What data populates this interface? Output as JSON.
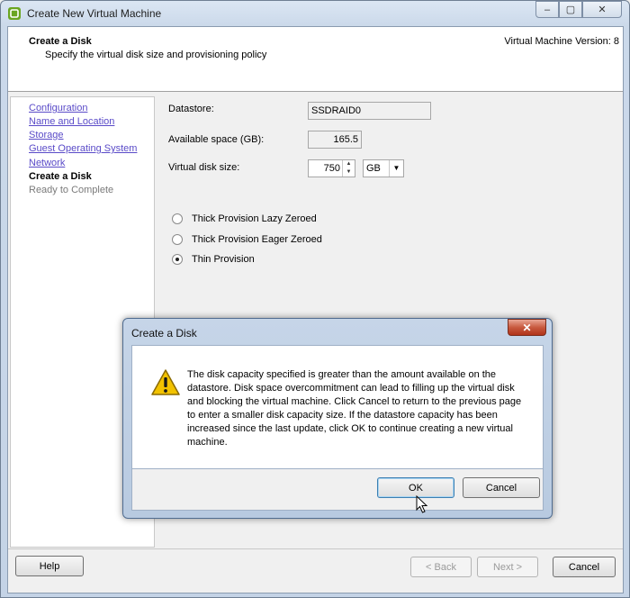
{
  "window": {
    "title": "Create New Virtual Machine",
    "controls": {
      "minimize": "–",
      "maximize": "▢",
      "close": "✕"
    }
  },
  "header": {
    "title": "Create a Disk",
    "subtitle": "Specify the virtual disk size and provisioning policy",
    "version": "Virtual Machine Version: 8"
  },
  "nav": {
    "items": [
      {
        "label": "Configuration",
        "state": "link"
      },
      {
        "label": "Name and Location",
        "state": "link"
      },
      {
        "label": "Storage",
        "state": "link"
      },
      {
        "label": "Guest Operating System",
        "state": "link"
      },
      {
        "label": "Network",
        "state": "link"
      },
      {
        "label": "Create a Disk",
        "state": "current"
      },
      {
        "label": "Ready to Complete",
        "state": "disabled"
      }
    ]
  },
  "form": {
    "datastore_label": "Datastore:",
    "datastore_value": "SSDRAID0",
    "available_label": "Available space (GB):",
    "available_value": "165.5",
    "disk_size_label": "Virtual disk size:",
    "disk_size_value": "750",
    "unit_value": "GB",
    "provisioning": [
      {
        "label": "Thick Provision Lazy Zeroed",
        "checked": false
      },
      {
        "label": "Thick Provision Eager Zeroed",
        "checked": false
      },
      {
        "label": "Thin Provision",
        "checked": true
      }
    ]
  },
  "footer": {
    "help": "Help",
    "back": "< Back",
    "next": "Next >",
    "cancel": "Cancel"
  },
  "dialog": {
    "title": "Create a Disk",
    "close": "✕",
    "message": "The disk capacity specified is greater than the amount available on the datastore. Disk space overcommitment can lead to filling up the virtual disk and blocking the virtual machine. Click Cancel to return to the previous page to enter a smaller disk capacity size. If the datastore capacity has been increased since the last update, click OK to continue creating a new virtual machine.",
    "ok": "OK",
    "cancel": "Cancel"
  },
  "colors": {
    "link": "#5a4bc8",
    "close_red": "#c85a3f",
    "warning_yellow": "#f2c200"
  }
}
